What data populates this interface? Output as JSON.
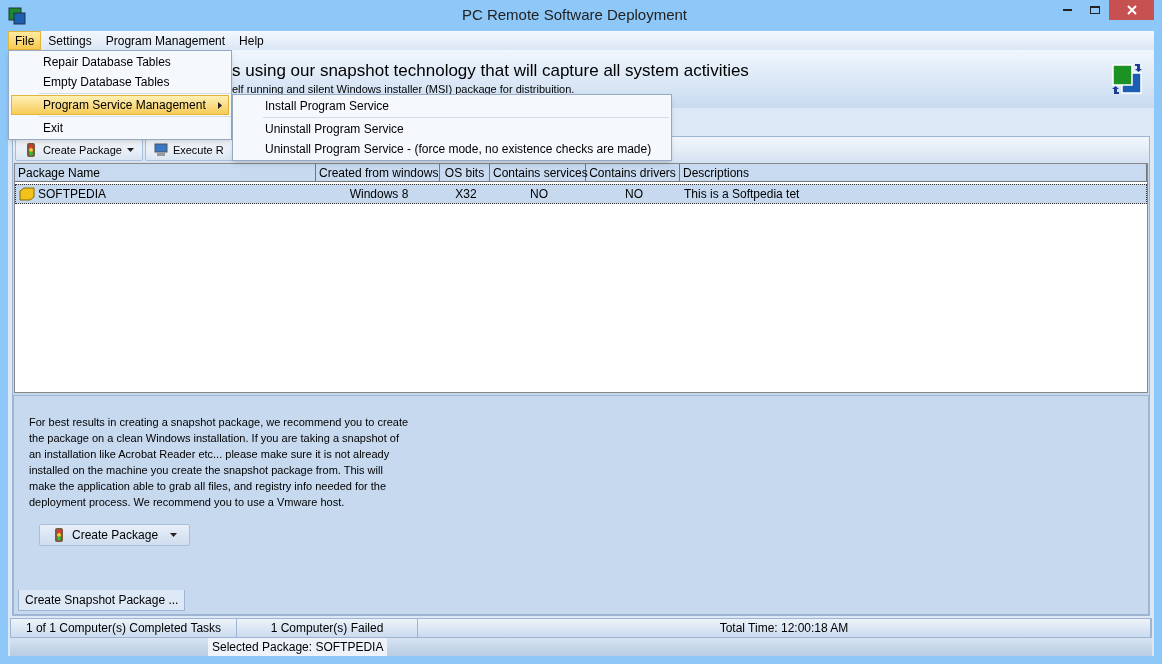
{
  "window": {
    "title": "PC Remote Software Deployment"
  },
  "menu_bar": [
    {
      "label": "File",
      "selected": true
    },
    {
      "label": "Settings",
      "selected": false
    },
    {
      "label": "Program Management",
      "selected": false
    },
    {
      "label": "Help",
      "selected": false
    }
  ],
  "file_menu": [
    {
      "label": "Repair Database Tables",
      "selected": false,
      "submenu": false
    },
    {
      "label": "Empty Database Tables",
      "selected": false,
      "submenu": false
    },
    {
      "label": "Program Service Management",
      "selected": true,
      "submenu": true
    },
    {
      "label": "Exit",
      "selected": false,
      "submenu": false
    }
  ],
  "submenu": [
    "Install Program Service",
    "Uninstall Program Service",
    "Uninstall Program Service - (force mode, no existence checks are made)"
  ],
  "banner": {
    "heading": "s using our snapshot technology that will capture all system activities",
    "subheading": "elf running and silent Windows installer (MSI) package for distribuition."
  },
  "toolbar": [
    "Create Package",
    "Execute R"
  ],
  "table": {
    "columns": [
      "Package Name",
      "Created from windows",
      "OS bits",
      "Contains services",
      "Contains drivers",
      "Descriptions"
    ],
    "rows": [
      {
        "selected": true,
        "cells": [
          "SOFTPEDIA",
          "Windows 8",
          "X32",
          "NO",
          "NO",
          "This is a Softpedia tet"
        ]
      }
    ]
  },
  "info_text": "For best results in creating a snapshot package, we recommend you to create the package on a clean Windows installation. If you are taking a snapshot of an installation like Acrobat Reader etc... please make sure it is not already installed on the machine you create the snapshot package from. This will make the application able to grab all files, and registry info needed for the deployment process. We recommend you to use a Vmware host.",
  "create_button": "Create Package",
  "tabs": [
    {
      "label": "Create Snapshot Package ...",
      "selected": true
    }
  ],
  "status_bar": [
    "1 of 1 Computer(s) Completed Tasks",
    "1 Computer(s) Failed",
    "Total Time: 12:00:18 AM"
  ],
  "status_bar_2": "Selected Package: SOFTPEDIA"
}
